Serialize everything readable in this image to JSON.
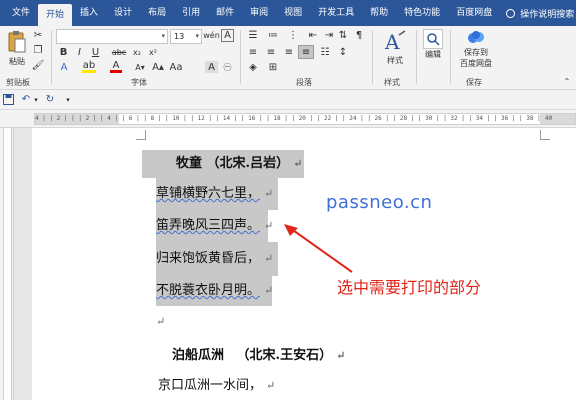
{
  "menu": {
    "tabs": [
      "文件",
      "开始",
      "插入",
      "设计",
      "布局",
      "引用",
      "邮件",
      "审阅",
      "视图",
      "开发工具",
      "帮助",
      "特色功能",
      "百度网盘"
    ],
    "active_tab": "开始",
    "tell_me": "操作说明搜索"
  },
  "ribbon": {
    "clipboard": {
      "paste_label": "粘贴",
      "group_label": "剪贴板"
    },
    "font": {
      "font_name": "",
      "font_size": "13",
      "group_label": "字体"
    },
    "paragraph": {
      "group_label": "段落"
    },
    "styles": {
      "styles_label": "样式",
      "group_label": "样式"
    },
    "editing": {
      "editing_label": "编辑"
    },
    "save": {
      "save_label_line1": "保存到",
      "save_label_line2": "百度网盘",
      "group_label": "保存"
    }
  },
  "ruler": {
    "numbers": "4 | | 2 | | | 2 | | 4 | | 6 | | 8 | | 10 | | 12 | | 14 | | 16 | | 18 | | 20 | | 22 | | 24 | | 26 | | 28 | | 30 | | 32 | | 34 | | 36 | | 38 |",
    "end_number": "40"
  },
  "document": {
    "poem1": {
      "title": "牧童",
      "author": "（北宋.吕岩）",
      "lines": [
        "草铺横野六七里，",
        "笛弄晚风三四声。",
        "归来饱饭黄昏后，",
        "不脱蓑衣卧月明。"
      ]
    },
    "poem2": {
      "title": "泊船瓜洲",
      "author": "（北宋.王安石）",
      "lines": [
        "京口瓜洲一水间，"
      ]
    },
    "para_mark": "↵"
  },
  "watermark": "passneo.cn",
  "annotation": "选中需要打印的部分",
  "colors": {
    "ribbon_blue": "#2b579a",
    "selection_gray": "#c8c8c8",
    "annotation_red": "#e0251b",
    "watermark_blue": "#3f6fd8"
  }
}
